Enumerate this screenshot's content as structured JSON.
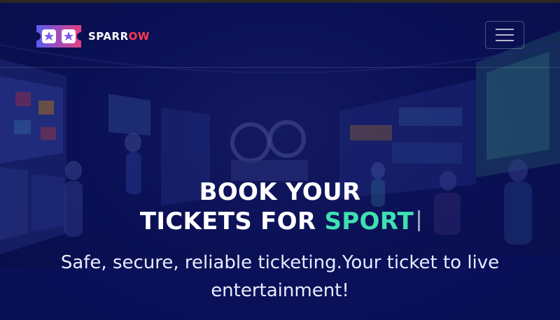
{
  "brand": {
    "name_part1": "SPARR",
    "name_part2": "OW",
    "logo_icon": "ticket-stars-icon"
  },
  "nav": {
    "menu_icon": "hamburger-menu-icon"
  },
  "hero": {
    "headline_line1": "BOOK YOUR",
    "headline_line2_prefix": "TICKETS FOR",
    "headline_line2_accent": "SPORT",
    "subtitle": "Safe, secure, reliable ticketing.Your ticket to live entertainment!"
  },
  "colors": {
    "background": "#0b1152",
    "accent": "#3ee0b0",
    "brand_red": "#ff3b4e",
    "logo_gradient_start": "#5b5cf0",
    "logo_gradient_end": "#e4407f"
  }
}
